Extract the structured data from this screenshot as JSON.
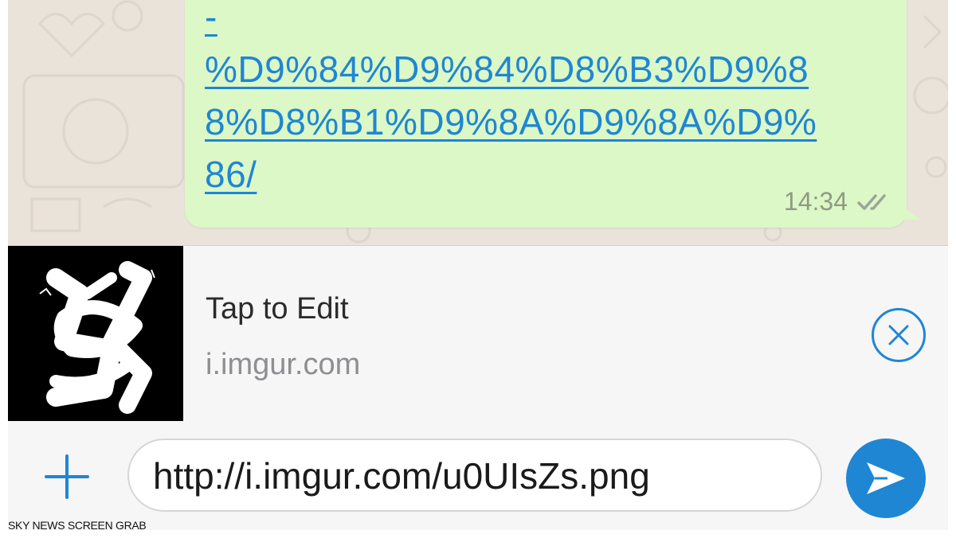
{
  "message": {
    "link_lines": [
      "-",
      "%D9%84%D9%84%D8%B3%D9%8",
      "8%D8%B1%D9%8A%D9%8A%D9%",
      "86/"
    ],
    "time": "14:34",
    "status_icon": "double-check-icon"
  },
  "link_preview": {
    "title": "Tap to Edit",
    "domain": "i.imgur.com",
    "thumbnail_icon": "scribble-thumbnail",
    "close_icon": "close-circle-icon"
  },
  "composer": {
    "attach_icon": "plus-icon",
    "text": "http://i.imgur.com/u0UIsZs.png",
    "send_icon": "send-icon"
  },
  "caption": "SKY NEWS SCREEN GRAB",
  "colors": {
    "accent": "#1f86d4",
    "bubble": "#dcf8c6",
    "wallpaper": "#e9e3da"
  }
}
